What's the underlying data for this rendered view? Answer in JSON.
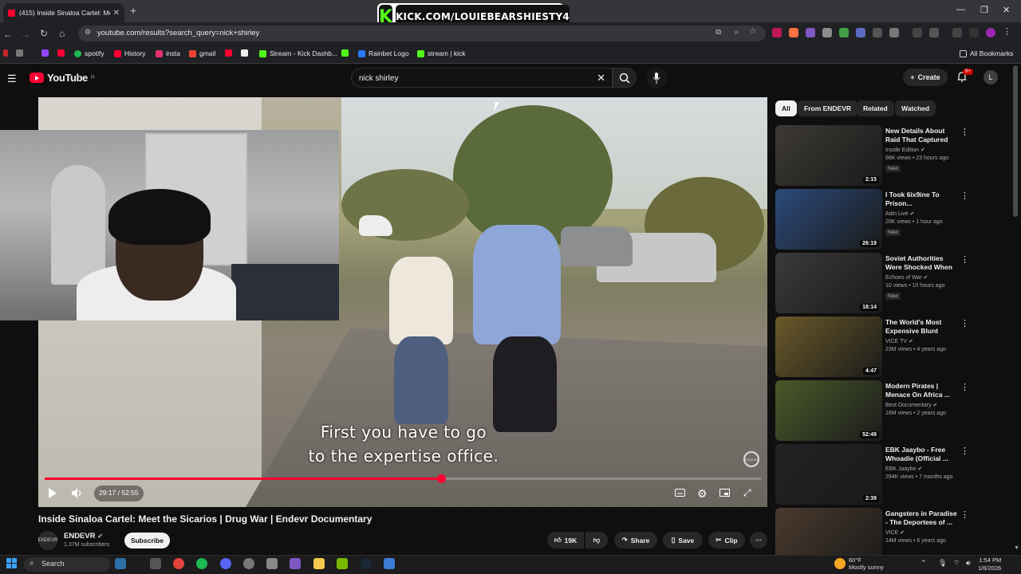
{
  "browser": {
    "tab_title": "(415) Inside Sinaloa Cartel: Me",
    "url": "youtube.com/results?search_query=nick+shirley",
    "bookmarks": [
      "spotify",
      "History",
      "insta",
      "gmail",
      "Stream - Kick Dashb...",
      "Rainbet Logo",
      "stream | kick"
    ],
    "all_bookmarks": "All Bookmarks"
  },
  "overlay": {
    "kick_text": "KICK.COM/LOUIEBEARSHIESTY4",
    "kick_logo": "K"
  },
  "youtube": {
    "logo": "YouTube",
    "logo_region": "FI",
    "search_query": "nick shirley",
    "create_label": "Create",
    "notif_count": "9+",
    "avatar_letter": "L"
  },
  "player": {
    "subtitle_line1": "First you have to go",
    "subtitle_line2": "to the expertise office.",
    "time": "29:17 / 52:55",
    "progress": 0.553,
    "watermark": "ENDEVR"
  },
  "video": {
    "title": "Inside Sinaloa Cartel: Meet the Sicarios | Drug War | Endevr Documentary",
    "channel": "ENDEVR",
    "channel_avatar": "ENDEVR",
    "subscribers": "1.37M subscribers",
    "subscribe_label": "Subscribe",
    "likes": "19K",
    "share_label": "Share",
    "save_label": "Save",
    "clip_label": "Clip"
  },
  "chips": [
    "All",
    "From ENDEVR",
    "Related",
    "Watched"
  ],
  "recommendations": [
    {
      "title": "New Details About Raid That Captured Nicola...",
      "channel": "Inside Edition",
      "meta": "66K views • 23 hours ago",
      "badge": "New",
      "duration": "2:15",
      "color": "#3d3a35"
    },
    {
      "title": "I Took 6ix9ine To Prison...",
      "channel": "Adin Live",
      "meta": "20K views • 1 hour ago",
      "badge": "New",
      "duration": "26:19",
      "color": "#2b4a7a"
    },
    {
      "title": "Soviet Authorities Were Shocked When Delta ...",
      "channel": "Echoes of War",
      "meta": "10 views • 10 hours ago",
      "badge": "New",
      "duration": "18:14",
      "color": "#3a3a3a"
    },
    {
      "title": "The World's Most Expensive Blunt Costs...",
      "channel": "VICE TV",
      "meta": "23M views • 4 years ago",
      "badge": "",
      "duration": "4:47",
      "color": "#6a5a2a"
    },
    {
      "title": "Modern Pirates | Menace On Africa ...",
      "channel": "Best Documentary",
      "meta": "16M views • 2 years ago",
      "badge": "",
      "duration": "52:49",
      "color": "#4a5a2a"
    },
    {
      "title": "EBK Jaaybo - Free Whoadie (Official ...",
      "channel": "EBK Jaaybo",
      "meta": "294K views • 7 months ago",
      "badge": "",
      "duration": "2:39",
      "color": "#222222"
    },
    {
      "title": "Gangsters in Paradise - The Deportees of ...",
      "channel": "VICE",
      "meta": "14M views • 6 years ago",
      "badge": "",
      "duration": "",
      "color": "#4a3a2e"
    }
  ],
  "taskbar": {
    "search_label": "Search",
    "temp": "60°F",
    "weather": "Mostly sunny",
    "time": "1:54 PM",
    "date": "1/6/2026"
  },
  "colors": {
    "accent": "#ff0033",
    "kick": "#53fc18",
    "bg": "#0f0f0f"
  }
}
